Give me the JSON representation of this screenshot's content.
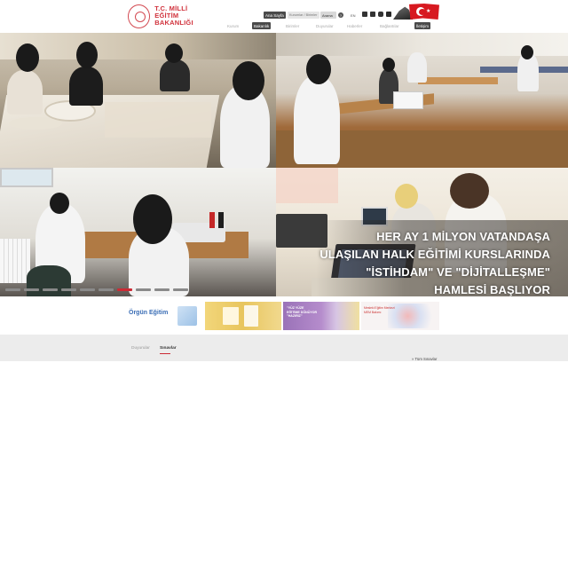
{
  "header": {
    "logo_text_line1": "T.C. MİLLİ EĞİTİM",
    "logo_text_line2": "BAKANLIĞI",
    "home_button": "Ana Sayfa",
    "search_placeholder": "Kurumlar / Birimler",
    "search_button": "Arama",
    "help_icon": "?",
    "language": "EN",
    "social_icons": [
      "facebook-icon",
      "twitter-icon",
      "instagram-icon",
      "youtube-icon"
    ]
  },
  "nav": {
    "items": [
      {
        "label": "Kurum",
        "active": false
      },
      {
        "label": "Bakanlık",
        "active": true
      },
      {
        "label": "Birimler",
        "active": false
      },
      {
        "label": "Duyurular",
        "active": false
      },
      {
        "label": "Haberler",
        "active": false
      },
      {
        "label": "Bağlantılar",
        "active": false
      },
      {
        "label": "İletişim",
        "active": true
      }
    ]
  },
  "hero": {
    "headline_lines": [
      "HER AY 1 MİLYON VATANDAŞA",
      "ULAŞILAN HALK EĞİTİMİ KURSLARINDA",
      "\"İSTİHDAM\" VE \"DİJİTALLEŞME\"",
      "HAMLESİ BAŞLIYOR"
    ],
    "slide_count": 10,
    "active_slide": 7
  },
  "banners": {
    "orgun_title": "Örgün Eğitim",
    "purple_text_line1": "\"YÜZ YÜZE",
    "purple_text_line2": "EĞİTİME DÖNÜYOR",
    "purple_text_line3": "\"HAZIRIZ\"",
    "mem_text_line1": "Mesleki Eğitim Merkezi",
    "mem_text_line2": "MEM Bakımı"
  },
  "tabs": {
    "items": [
      "Duyurular",
      "Sınavlar"
    ],
    "active": "Sınavlar",
    "all_link": "Tüm Sınavlar"
  },
  "colors": {
    "brand_red": "#cc2b36",
    "nav_active": "#4a4a4a",
    "grey_band": "#ececec"
  }
}
